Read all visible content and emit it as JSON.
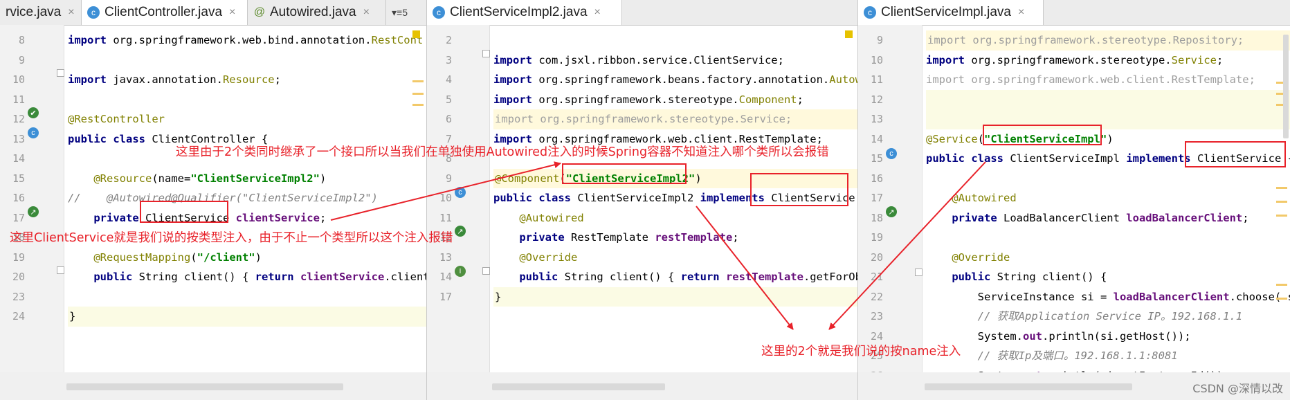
{
  "panes": {
    "left": {
      "tabs": [
        {
          "label": "rvice.java",
          "close": "×"
        },
        {
          "label": "ClientController.java",
          "close": "×",
          "active": true
        },
        {
          "label": "Autowired.java",
          "close": "×"
        }
      ],
      "overflow_label": "▾≡5",
      "lines": [
        {
          "n": "8",
          "segs": [
            [
              "kw",
              "import "
            ],
            [
              "",
              "org.springframework.web.bind.annotation."
            ],
            [
              "ann",
              "RestCont"
            ]
          ]
        },
        {
          "n": "9",
          "segs": []
        },
        {
          "n": "10",
          "segs": [
            [
              "kw",
              "import "
            ],
            [
              "",
              "javax.annotation."
            ],
            [
              "ann",
              "Resource"
            ],
            [
              "",
              ";"
            ]
          ]
        },
        {
          "n": "11",
          "segs": []
        },
        {
          "n": "12",
          "segs": [
            [
              "ann",
              "@RestController"
            ]
          ]
        },
        {
          "n": "13",
          "segs": [
            [
              "kw",
              "public class "
            ],
            [
              "",
              "ClientController {"
            ]
          ]
        },
        {
          "n": "14",
          "segs": []
        },
        {
          "n": "15",
          "segs": [
            [
              "",
              "    "
            ],
            [
              "ann",
              "@Resource"
            ],
            [
              "",
              "(name="
            ],
            [
              "str",
              "\"ClientServiceImpl2\""
            ],
            [
              "",
              ")"
            ]
          ]
        },
        {
          "n": "16",
          "segs": [
            [
              "cmt",
              "//    @Autowired@Qualifier(\"ClientServiceImpl2\")"
            ]
          ]
        },
        {
          "n": "17",
          "segs": [
            [
              "",
              "    "
            ],
            [
              "kw",
              "private "
            ],
            [
              "",
              "ClientService "
            ],
            [
              "fld",
              "clientService"
            ],
            [
              "",
              ";"
            ]
          ]
        },
        {
          "n": "18",
          "segs": []
        },
        {
          "n": "19",
          "segs": [
            [
              "",
              "    "
            ],
            [
              "ann",
              "@RequestMapping"
            ],
            [
              "",
              "("
            ],
            [
              "str",
              "\"/client\""
            ],
            [
              "",
              ")"
            ]
          ]
        },
        {
          "n": "20",
          "segs": [
            [
              "",
              "    "
            ],
            [
              "kw",
              "public "
            ],
            [
              "",
              "String client() { "
            ],
            [
              "kw",
              "return "
            ],
            [
              "fld",
              "clientService"
            ],
            [
              "",
              ".client("
            ]
          ]
        },
        {
          "n": "23",
          "segs": []
        },
        {
          "n": "24",
          "segs": [
            [
              "",
              "}"
            ]
          ]
        }
      ]
    },
    "middle": {
      "tabs": [
        {
          "label": "ClientServiceImpl2.java",
          "close": "×",
          "active": true
        }
      ],
      "lines": [
        {
          "n": "2",
          "segs": []
        },
        {
          "n": "3",
          "segs": [
            [
              "kw",
              "import "
            ],
            [
              "",
              "com.jsxl.ribbon.service.ClientService;"
            ]
          ]
        },
        {
          "n": "4",
          "segs": [
            [
              "kw",
              "import "
            ],
            [
              "",
              "org.springframework.beans.factory.annotation."
            ],
            [
              "ann",
              "Autowir"
            ]
          ]
        },
        {
          "n": "5",
          "segs": [
            [
              "kw",
              "import "
            ],
            [
              "",
              "org.springframework.stereotype."
            ],
            [
              "ann",
              "Component"
            ],
            [
              "",
              ";"
            ]
          ]
        },
        {
          "n": "6",
          "segs": [
            [
              "gray",
              "import org.springframework.stereotype.Service;"
            ]
          ]
        },
        {
          "n": "7",
          "segs": [
            [
              "kw",
              "import "
            ],
            [
              "",
              "org.springframework.web.client.RestTemplate;"
            ]
          ]
        },
        {
          "n": "8",
          "segs": []
        },
        {
          "n": "9",
          "segs": [
            [
              "ann",
              "@Component"
            ],
            [
              "",
              "("
            ],
            [
              "str",
              "\"ClientServiceImpl2\""
            ],
            [
              "",
              ")"
            ]
          ]
        },
        {
          "n": "10",
          "segs": [
            [
              "kw",
              "public class "
            ],
            [
              "",
              "ClientServiceImpl2 "
            ],
            [
              "kw",
              "implements "
            ],
            [
              "",
              "ClientService {"
            ]
          ]
        },
        {
          "n": "11",
          "segs": [
            [
              "",
              "    "
            ],
            [
              "ann",
              "@Autowired"
            ]
          ]
        },
        {
          "n": "12",
          "segs": [
            [
              "",
              "    "
            ],
            [
              "kw",
              "private "
            ],
            [
              "",
              "RestTemplate "
            ],
            [
              "fld",
              "restTemplate"
            ],
            [
              "",
              ";"
            ]
          ]
        },
        {
          "n": "13",
          "segs": [
            [
              "",
              "    "
            ],
            [
              "ann",
              "@Override"
            ]
          ]
        },
        {
          "n": "14",
          "segs": [
            [
              "",
              "    "
            ],
            [
              "kw",
              "public "
            ],
            [
              "",
              "String client() { "
            ],
            [
              "kw",
              "return "
            ],
            [
              "fld",
              "restTemplate"
            ],
            [
              "",
              ".getForObje"
            ]
          ]
        },
        {
          "n": "17",
          "segs": [
            [
              "",
              "}"
            ]
          ]
        }
      ]
    },
    "right": {
      "tabs": [
        {
          "label": "ClientServiceImpl.java",
          "close": "×",
          "active": true
        }
      ],
      "lines": [
        {
          "n": "9",
          "segs": [
            [
              "gray",
              "import org.springframework.stereotype.Repository;"
            ]
          ]
        },
        {
          "n": "10",
          "segs": [
            [
              "kw",
              "import "
            ],
            [
              "",
              "org.springframework.stereotype."
            ],
            [
              "ann",
              "Service"
            ],
            [
              "",
              ";"
            ]
          ]
        },
        {
          "n": "11",
          "segs": [
            [
              "gray",
              "import org.springframework.web.client.RestTemplate;"
            ]
          ]
        },
        {
          "n": "12",
          "segs": []
        },
        {
          "n": "13",
          "segs": []
        },
        {
          "n": "14",
          "segs": [
            [
              "ann",
              "@Service"
            ],
            [
              "",
              "("
            ],
            [
              "str",
              "\"ClientServiceImpl\""
            ],
            [
              "",
              ")"
            ]
          ]
        },
        {
          "n": "15",
          "segs": [
            [
              "kw",
              "public class "
            ],
            [
              "",
              "ClientServiceImpl "
            ],
            [
              "kw",
              "implements "
            ],
            [
              "",
              "ClientService {"
            ]
          ]
        },
        {
          "n": "16",
          "segs": []
        },
        {
          "n": "17",
          "segs": [
            [
              "",
              "    "
            ],
            [
              "ann",
              "@Autowired"
            ]
          ]
        },
        {
          "n": "18",
          "segs": [
            [
              "",
              "    "
            ],
            [
              "kw",
              "private "
            ],
            [
              "",
              "LoadBalancerClient "
            ],
            [
              "fld",
              "loadBalancerClient"
            ],
            [
              "",
              ";"
            ]
          ]
        },
        {
          "n": "19",
          "segs": []
        },
        {
          "n": "20",
          "segs": [
            [
              "",
              "    "
            ],
            [
              "ann",
              "@Override"
            ]
          ]
        },
        {
          "n": "21",
          "segs": [
            [
              "",
              "    "
            ],
            [
              "kw",
              "public "
            ],
            [
              "",
              "String client() {"
            ]
          ]
        },
        {
          "n": "22",
          "segs": [
            [
              "",
              "        ServiceInstance si = "
            ],
            [
              "fld",
              "loadBalancerClient"
            ],
            [
              "",
              ".choose( se"
            ]
          ]
        },
        {
          "n": "23",
          "segs": [
            [
              "cmt",
              "        // 获取Application Service IP。192.168.1.1"
            ]
          ]
        },
        {
          "n": "24",
          "segs": [
            [
              "",
              "        System."
            ],
            [
              "fld",
              "out"
            ],
            [
              "",
              ".println(si.getHost());"
            ]
          ]
        },
        {
          "n": "25",
          "segs": [
            [
              "cmt",
              "        // 获取Ip及端口。192.168.1.1:8081"
            ]
          ]
        },
        {
          "n": "26",
          "segs": [
            [
              "",
              "        System."
            ],
            [
              "fld",
              "out"
            ],
            [
              "",
              ".println(si.getInstanceId());"
            ]
          ]
        }
      ]
    }
  },
  "annotations": {
    "note_top": "这里由于2个类同时继承了一个接口所以当我们在单独使用Autowired注入的时候Spring容器不知道注入哪个类所以会报错",
    "note_left": "这里ClientService就是我们说的按类型注入，由于不止一个类型所以这个注入报错",
    "note_bottom": "这里的2个就是我们说的按name注入",
    "color": "#e8222a"
  },
  "watermark": "CSDN @深情以改"
}
